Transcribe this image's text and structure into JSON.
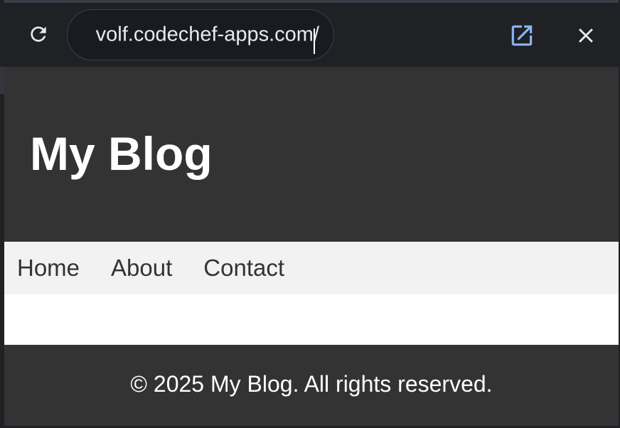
{
  "browser": {
    "url": "volf.codechef-apps.com/",
    "icons": {
      "reload": "reload-icon",
      "open_external": "open-in-new-icon",
      "close": "close-icon"
    },
    "colors": {
      "toolbar": "#202124",
      "url_text": "#e8eaed",
      "open_icon": "#8ab4f8",
      "close_icon": "#e8eaed"
    }
  },
  "site": {
    "header": {
      "title": "My Blog"
    },
    "nav": {
      "items": [
        {
          "label": "Home"
        },
        {
          "label": "About"
        },
        {
          "label": "Contact"
        }
      ]
    },
    "footer": {
      "text": "© 2025 My Blog. All rights reserved."
    },
    "colors": {
      "header_bg": "#333333",
      "nav_bg": "#f2f2f2",
      "footer_bg": "#333333"
    }
  }
}
